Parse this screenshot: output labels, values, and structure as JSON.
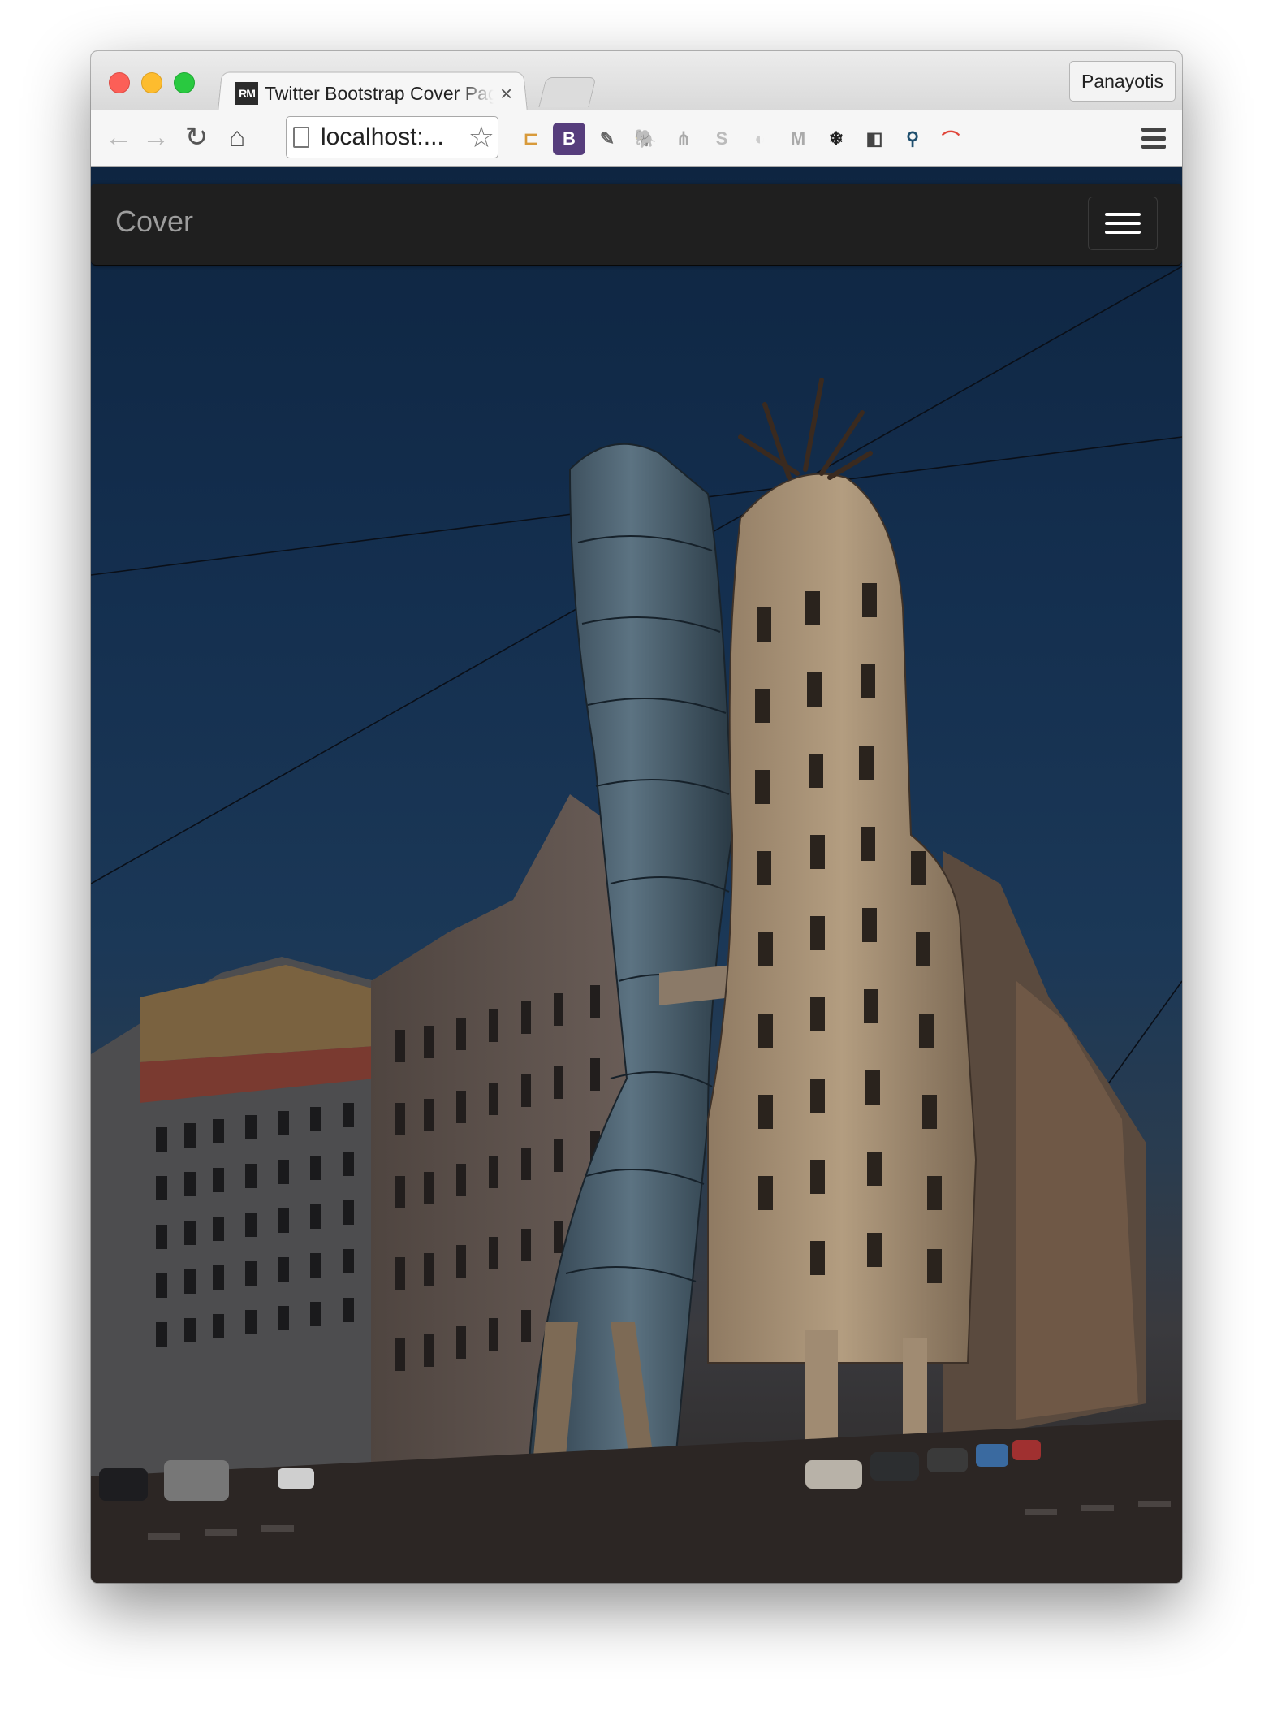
{
  "browser": {
    "tab": {
      "favicon_text": "RM",
      "title": "Twitter Bootstrap Cover Page",
      "close_label": "×"
    },
    "profile_name": "Panayotis",
    "address_bar": {
      "url": "localhost:..."
    },
    "nav": {
      "back": "←",
      "forward": "→",
      "reload": "↻",
      "home": "⌂"
    },
    "extensions": [
      {
        "name": "ruler-extension-icon",
        "glyph": "⊏",
        "color": "#d89a3a"
      },
      {
        "name": "bootstrap-extension-icon",
        "glyph": "B",
        "color": "#563d7c"
      },
      {
        "name": "eyedropper-extension-icon",
        "glyph": "✎",
        "color": "#666666"
      },
      {
        "name": "evernote-extension-icon",
        "glyph": "🐘",
        "color": "#555555"
      },
      {
        "name": "sitemap-extension-icon",
        "glyph": "⋔",
        "color": "#aaaaaa"
      },
      {
        "name": "skype-extension-icon",
        "glyph": "S",
        "color": "#bbbbbb"
      },
      {
        "name": "swirl-extension-icon",
        "glyph": "◐",
        "color": "#cccccc"
      },
      {
        "name": "markdown-extension-icon",
        "glyph": "M",
        "color": "#aaaaaa"
      },
      {
        "name": "snowflake-extension-icon",
        "glyph": "❄",
        "color": "#222222"
      },
      {
        "name": "shield-extension-icon",
        "glyph": "◧",
        "color": "#444444"
      },
      {
        "name": "map-pin-extension-icon",
        "glyph": "⚲",
        "color": "#1f4f6e"
      },
      {
        "name": "rainbow-extension-icon",
        "glyph": "⌒",
        "color": "#e0463a"
      }
    ]
  },
  "page": {
    "brand": "Cover",
    "colors": {
      "navbar_bg": "#1f1f1f",
      "brand_text": "#9d9d9d",
      "sky_top": "#0e2541"
    }
  }
}
